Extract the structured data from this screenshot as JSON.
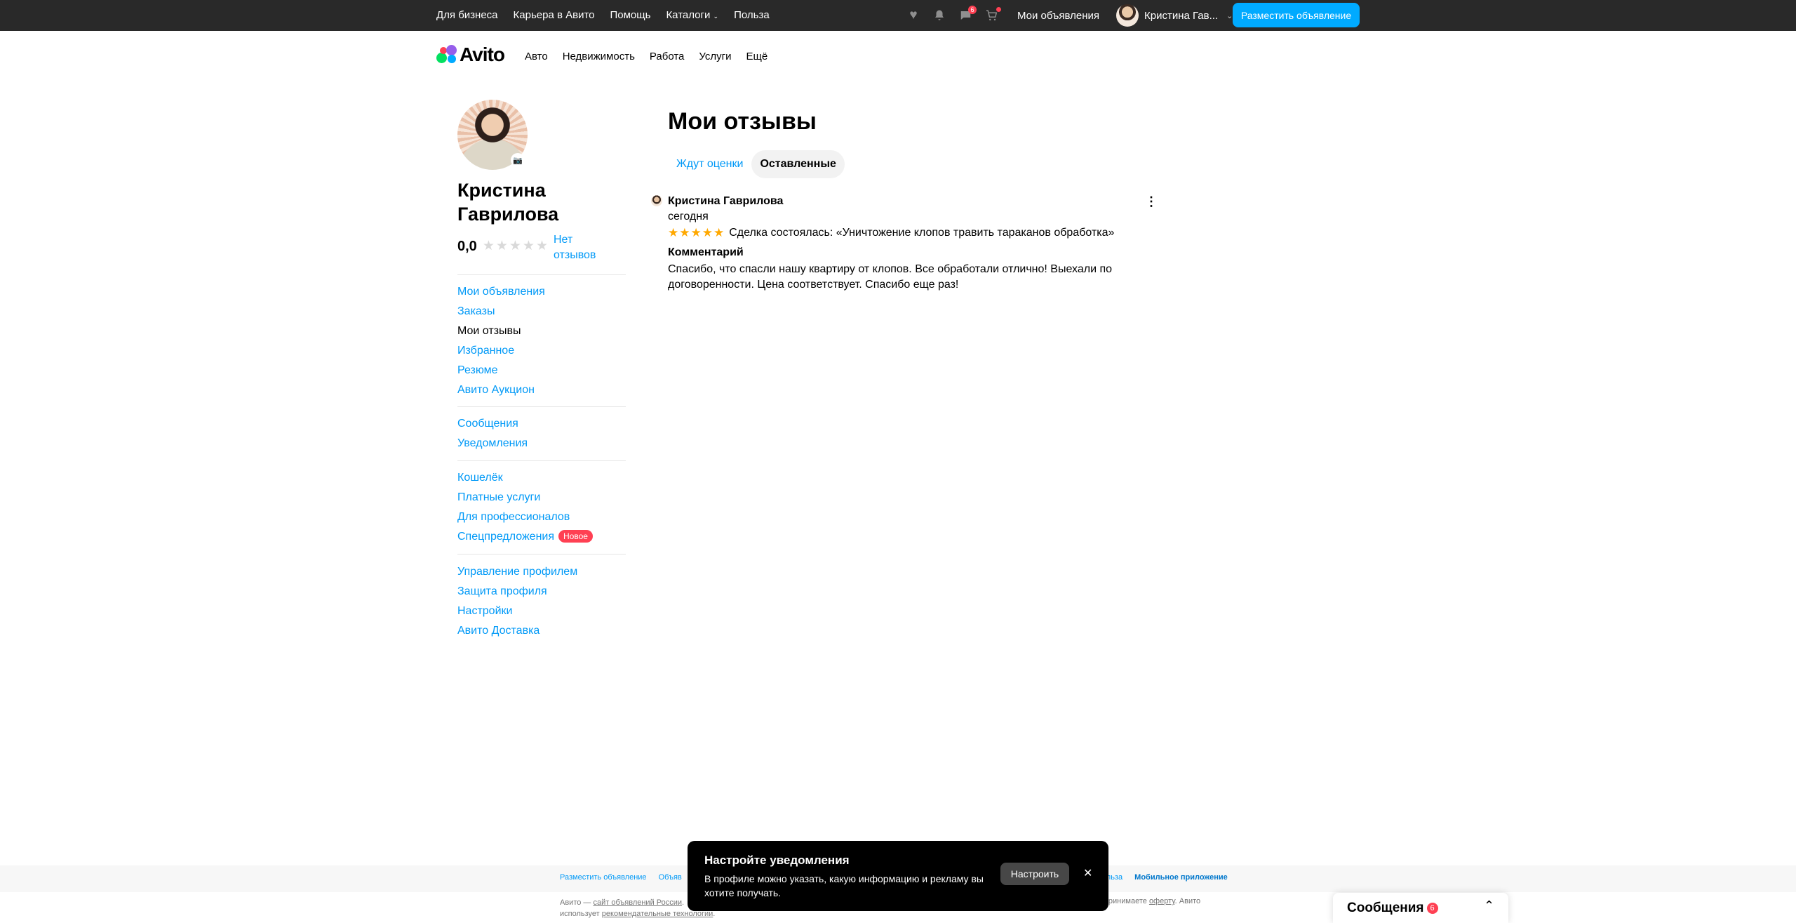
{
  "topbar": {
    "links": [
      "Для бизнеса",
      "Карьера в Авито",
      "Помощь",
      "Каталоги",
      "Польза"
    ],
    "messages_badge": "6",
    "my_ads": "Мои объявления",
    "user_name": "Кристина Гав...",
    "post_button": "Разместить объявление"
  },
  "header": {
    "logo": "Avito",
    "nav": [
      "Авто",
      "Недвижимость",
      "Работа",
      "Услуги",
      "Ещё"
    ]
  },
  "sidebar": {
    "name": "Кристина Гаврилова",
    "rating_value": "0,0",
    "rating_stars": 0,
    "no_reviews": "Нет отзывов",
    "group1": [
      "Мои объявления",
      "Заказы",
      "Мои отзывы",
      "Избранное",
      "Резюме",
      "Авито Аукцион"
    ],
    "group2": [
      "Сообщения",
      "Уведомления"
    ],
    "group3": [
      "Кошелёк",
      "Платные услуги",
      "Для профессионалов",
      "Спецпредложения"
    ],
    "new_badge": "Новое",
    "group4": [
      "Управление профилем",
      "Защита профиля",
      "Настройки",
      "Авито Доставка"
    ]
  },
  "main": {
    "title": "Мои отзывы",
    "tabs": [
      "Ждут оценки",
      "Оставленные"
    ],
    "review": {
      "author": "Кристина Гаврилова",
      "date": "сегодня",
      "stars": 5,
      "deal": "Сделка состоялась: «Уничтожение клопов травить тараканов обработка»",
      "comment_title": "Комментарий",
      "comment": "Спасибо, что спасли нашу квартиру от клопов. Все обработали отлично! Выехали по договоренности. Цена соответствует. Спасибо еще раз!"
    }
  },
  "footer": {
    "links": [
      "Разместить объявление",
      "Объяв"
    ],
    "right_link": "Польза",
    "mobile_app": "Мобильное приложение",
    "copy_line1_a": "Авито —",
    "copy_line1_link": "сайт объявлений России",
    "copy_line1_b": ".",
    "copy_line2_a": "использует",
    "copy_line2_link": "рекомендательные технологии",
    "copy_line2_b": ".",
    "copy_right_a": "ы принимаете",
    "copy_right_link": "оферту",
    "copy_right_b": ". Авито"
  },
  "notification": {
    "title": "Настройте уведомления",
    "text": "В профиле можно указать, какую информацию и рекламу вы хотите получать.",
    "button": "Настроить"
  },
  "messages_widget": {
    "title": "Сообщения",
    "badge": "6"
  },
  "colors": {
    "accent": "#00aaff",
    "link": "#0099f7",
    "badge": "#ff4053",
    "star": "#ffa800",
    "topbar": "#292929"
  }
}
